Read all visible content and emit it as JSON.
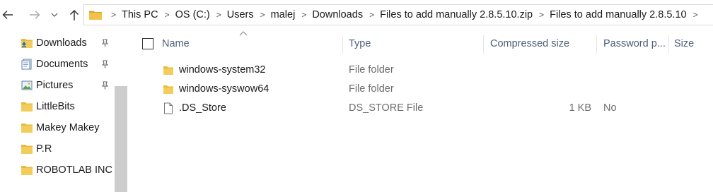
{
  "breadcrumbs": [
    "This PC",
    "OS (C:)",
    "Users",
    "malej",
    "Downloads",
    "Files to add manually 2.8.5.10.zip",
    "Files to add manually 2.8.5.10"
  ],
  "nav_pane": {
    "items": [
      {
        "label": "Downloads",
        "icon": "download-folder-icon",
        "pinned": true
      },
      {
        "label": "Documents",
        "icon": "documents-icon",
        "pinned": true
      },
      {
        "label": "Pictures",
        "icon": "pictures-icon",
        "pinned": true
      },
      {
        "label": "LittleBits",
        "icon": "folder-icon",
        "pinned": false
      },
      {
        "label": "Makey Makey",
        "icon": "folder-icon",
        "pinned": false
      },
      {
        "label": "P.R",
        "icon": "folder-icon",
        "pinned": false
      },
      {
        "label": "ROBOTLAB INC",
        "icon": "folder-icon",
        "pinned": false
      }
    ]
  },
  "columns": {
    "name": "Name",
    "type": "Type",
    "compressed_size": "Compressed size",
    "password": "Password p...",
    "size": "Size"
  },
  "files": [
    {
      "name": "windows-system32",
      "type": "File folder",
      "compressed_size": "",
      "password": "",
      "icon": "folder-icon"
    },
    {
      "name": "windows-syswow64",
      "type": "File folder",
      "compressed_size": "",
      "password": "",
      "icon": "folder-icon"
    },
    {
      "name": ".DS_Store",
      "type": "DS_STORE File",
      "compressed_size": "1 KB",
      "password": "No",
      "icon": "file-icon"
    }
  ],
  "colors": {
    "folder": "#e8b93d",
    "folder_dark": "#d9a425",
    "header_text": "#4c607a",
    "accent": "#2b6cc4"
  }
}
